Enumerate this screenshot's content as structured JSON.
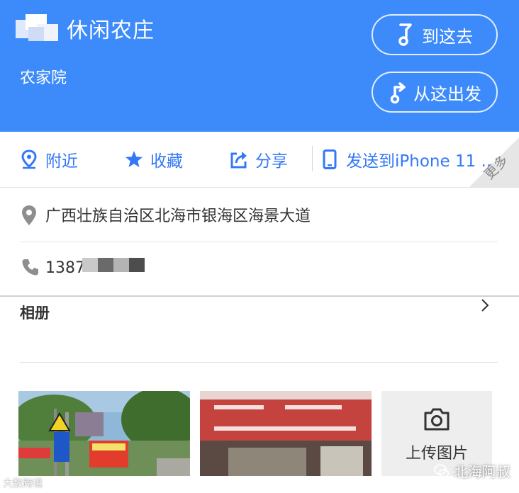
{
  "header": {
    "title": "休闲农庄",
    "subtitle": "农家院",
    "go_here_label": "到这去",
    "from_here_label": "从这出发"
  },
  "actions": {
    "nearby_label": "附近",
    "favorite_label": "收藏",
    "share_label": "分享",
    "send_label": "发送到iPhone 11 ..",
    "more_label": "更多"
  },
  "details": {
    "address": "广西壮族自治区北海市银海区海景大道",
    "phone_visible": "1387"
  },
  "album": {
    "title": "相册",
    "upload_label": "上传图片"
  },
  "watermarks": {
    "left": "大数跨境",
    "right": "北海阿叔"
  },
  "colors": {
    "brand_blue": "#3d8bfb",
    "action_blue": "#3478f6"
  }
}
